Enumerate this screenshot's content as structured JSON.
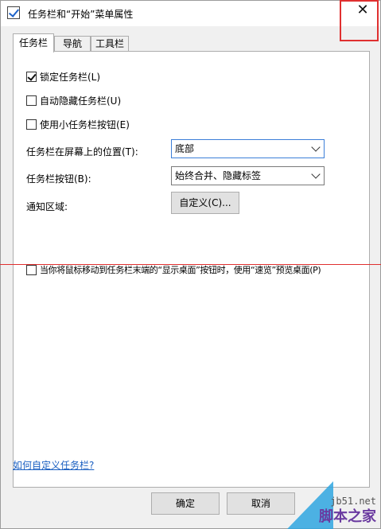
{
  "window": {
    "title": "任务栏和“开始”菜单属性",
    "close_glyph": "✕"
  },
  "tabs": [
    {
      "label": "任务栏",
      "active": true
    },
    {
      "label": "导航",
      "active": false
    },
    {
      "label": "工具栏",
      "active": false
    }
  ],
  "taskbar": {
    "lock_label": "锁定任务栏(L)",
    "lock_checked": true,
    "autohide_label": "自动隐藏任务栏(U)",
    "autohide_checked": false,
    "small_buttons_label": "使用小任务栏按钮(E)",
    "small_buttons_checked": false,
    "location_label": "任务栏在屏幕上的位置(T):",
    "location_value": "底部",
    "buttons_label": "任务栏按钮(B):",
    "buttons_value": "始终合并、隐藏标签",
    "notify_label": "通知区域:",
    "customize_button": "自定义(C)...",
    "peek_label": "当你将鼠标移动到任务栏末端的“显示桌面”按钮时，使用“速览”预览桌面(P)",
    "peek_checked": false,
    "help_link": "如何自定义任务栏?"
  },
  "footer": {
    "ok_button": "确定",
    "cancel_button": "取消"
  },
  "watermark": {
    "site": "jb51.net",
    "name": "脚本之家"
  },
  "colors": {
    "accent_red": "#e03030",
    "link_blue": "#1a5fc1"
  }
}
